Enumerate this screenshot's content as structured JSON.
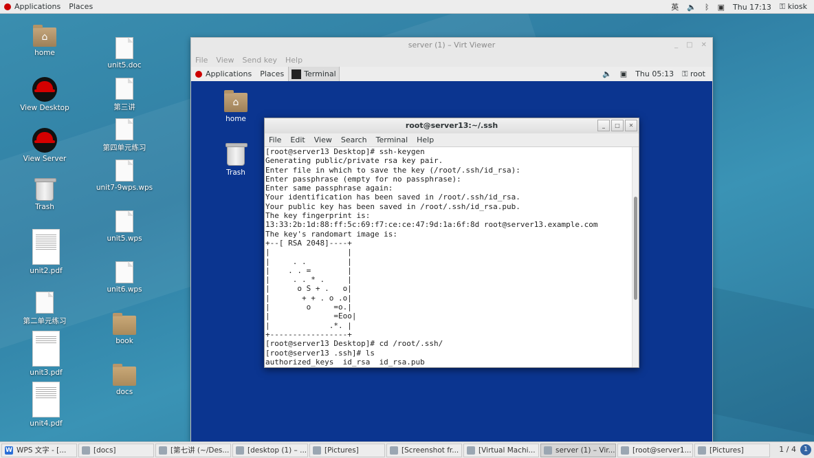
{
  "top_panel": {
    "applications": "Applications",
    "places": "Places",
    "input_method": "英",
    "clock": "Thu 17:13",
    "user": "kiosk"
  },
  "desktop": {
    "icons": [
      {
        "label": "home"
      },
      {
        "label": "View Desktop"
      },
      {
        "label": "View Server"
      },
      {
        "label": "Trash"
      },
      {
        "label": "unit2.pdf"
      },
      {
        "label": "第二单元练习"
      },
      {
        "label": "unit3.pdf"
      },
      {
        "label": "unit4.pdf"
      },
      {
        "label": "unit5.doc"
      },
      {
        "label": "第三讲"
      },
      {
        "label": "第四单元练习"
      },
      {
        "label": "unit7-9wps.wps"
      },
      {
        "label": "unit5.wps"
      },
      {
        "label": "unit6.wps"
      },
      {
        "label": "book"
      },
      {
        "label": "docs"
      }
    ]
  },
  "virt_viewer": {
    "title": "server (1) – Virt Viewer",
    "menu": [
      "File",
      "View",
      "Send key",
      "Help"
    ],
    "guest": {
      "applications": "Applications",
      "places": "Places",
      "terminal_task": "Terminal",
      "clock": "Thu 05:13",
      "user": "root",
      "icons": [
        {
          "label": "home"
        },
        {
          "label": "Trash"
        }
      ],
      "terminal": {
        "title": "root@server13:~/.ssh",
        "menu": [
          "File",
          "Edit",
          "View",
          "Search",
          "Terminal",
          "Help"
        ],
        "lines": [
          "[root@server13 Desktop]# ssh-keygen",
          "Generating public/private rsa key pair.",
          "Enter file in which to save the key (/root/.ssh/id_rsa):",
          "Enter passphrase (empty for no passphrase):",
          "Enter same passphrase again:",
          "Your identification has been saved in /root/.ssh/id_rsa.",
          "Your public key has been saved in /root/.ssh/id_rsa.pub.",
          "The key fingerprint is:",
          "13:33:2b:1d:88:ff:5c:69:f7:ce:ce:47:9d:1a:6f:8d root@server13.example.com",
          "The key's randomart image is:",
          "+--[ RSA 2048]----+",
          "|                 |",
          "|     . .         |",
          "|    . . =        |",
          "|     . . * .     |",
          "|      o S + .   o|",
          "|       + + . o .o|",
          "|        o     =o.|",
          "|              =Eoo|",
          "|             .*. |",
          "+-----------------+",
          "[root@server13 Desktop]# cd /root/.ssh/",
          "[root@server13 .ssh]# ls",
          "authorized_keys  id_rsa  id_rsa.pub"
        ]
      }
    }
  },
  "taskbar": {
    "items": [
      {
        "label": "WPS 文字 - [..."
      },
      {
        "label": "[docs]"
      },
      {
        "label": "[第七讲 (~/Des..."
      },
      {
        "label": "[desktop (1) – ..."
      },
      {
        "label": "[Pictures]"
      },
      {
        "label": "[Screenshot fr..."
      },
      {
        "label": "[Virtual Machi..."
      },
      {
        "label": "server (1) – Vir..."
      },
      {
        "label": "[root@server1..."
      },
      {
        "label": "[Pictures]"
      }
    ],
    "pager": "1 / 4",
    "notification": "1"
  }
}
